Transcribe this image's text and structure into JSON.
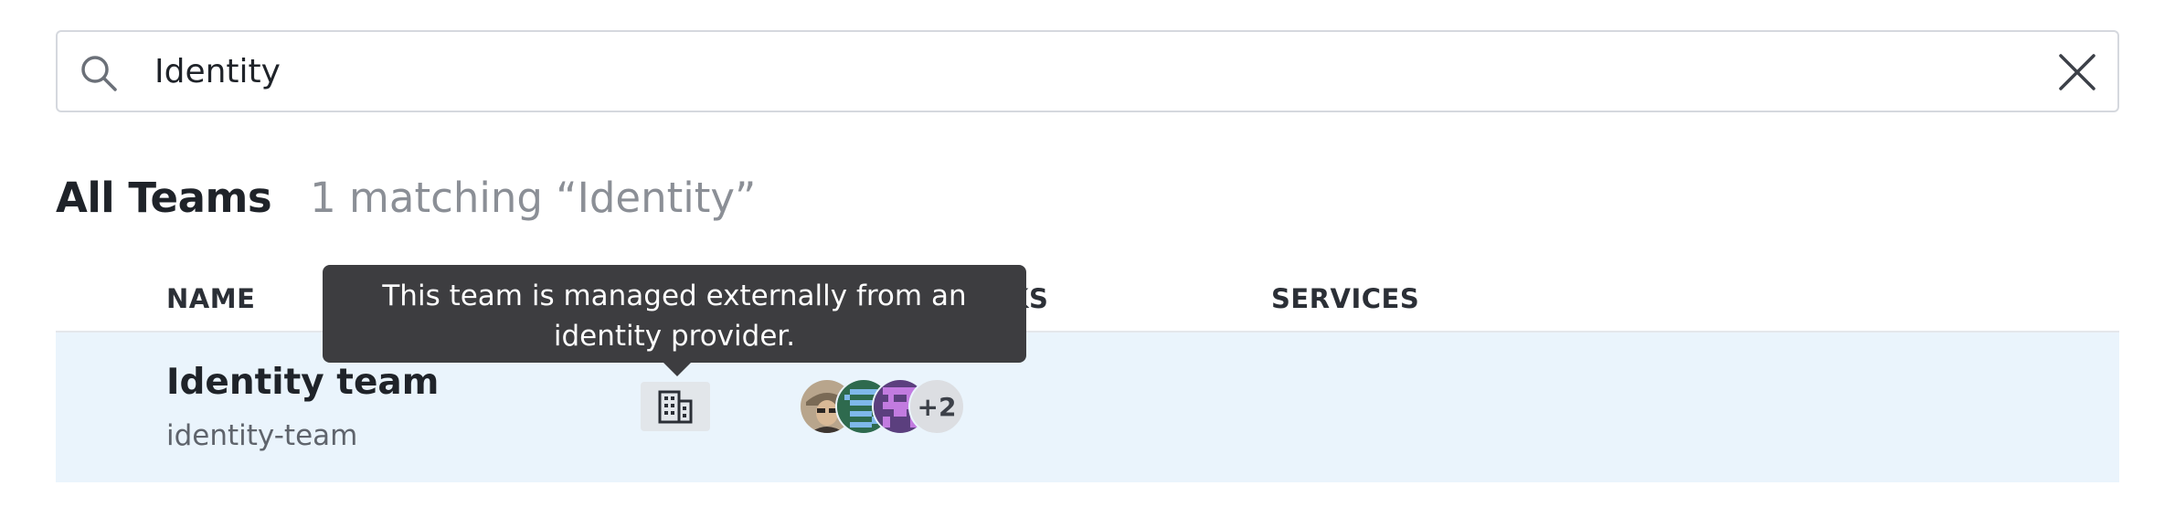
{
  "search": {
    "value": "Identity",
    "placeholder": ""
  },
  "heading": {
    "title": "All Teams",
    "subtitle": "1 matching “Identity”"
  },
  "table": {
    "columns": {
      "name": "NAME",
      "links": "LINKS",
      "services": "SERVICES"
    },
    "rows": [
      {
        "name": "Identity team",
        "handle": "identity-team",
        "managed_icon": "building-icon",
        "members_more": "+2"
      }
    ]
  },
  "tooltip": {
    "text": "This team is managed externally from an identity provider."
  }
}
